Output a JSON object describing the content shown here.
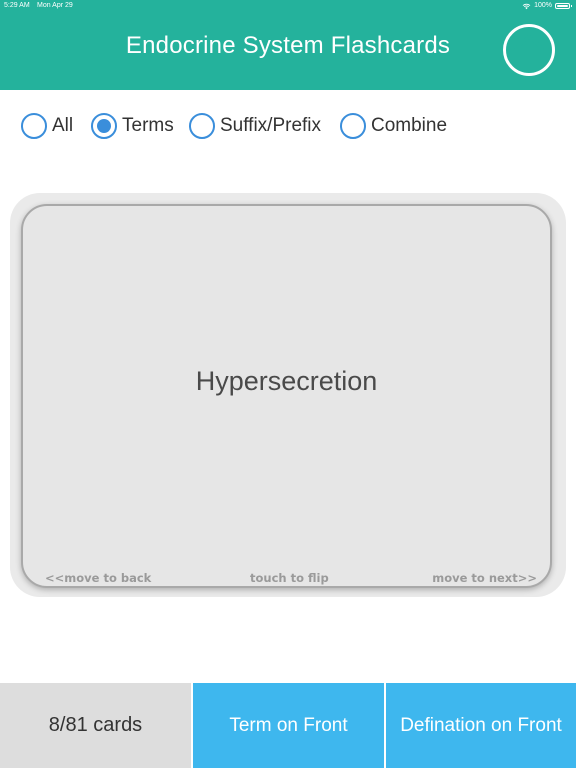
{
  "status_bar": {
    "time": "5:29 AM",
    "date": "Mon Apr 29",
    "battery": "100%",
    "wifi_icon": "wifi-icon",
    "battery_icon": "battery-icon"
  },
  "header": {
    "title": "Endocrine System Flashcards",
    "home_icon": "home-icon",
    "color": "#24b29c"
  },
  "filters": {
    "options": [
      {
        "label": "All",
        "selected": false
      },
      {
        "label": "Terms",
        "selected": true
      },
      {
        "label": "Suffix/Prefix",
        "selected": false
      },
      {
        "label": "Combine",
        "selected": false
      }
    ],
    "accent": "#3a8edb"
  },
  "card": {
    "term": "Hypersecretion",
    "hint_back": "<<move to back",
    "hint_flip": "touch to flip",
    "hint_next": "move to next>>"
  },
  "footer": {
    "counter": "8/81 cards",
    "term_front_label": "Term on Front",
    "definition_front_label": "Defination on Front",
    "button_color": "#3eb7ee"
  }
}
